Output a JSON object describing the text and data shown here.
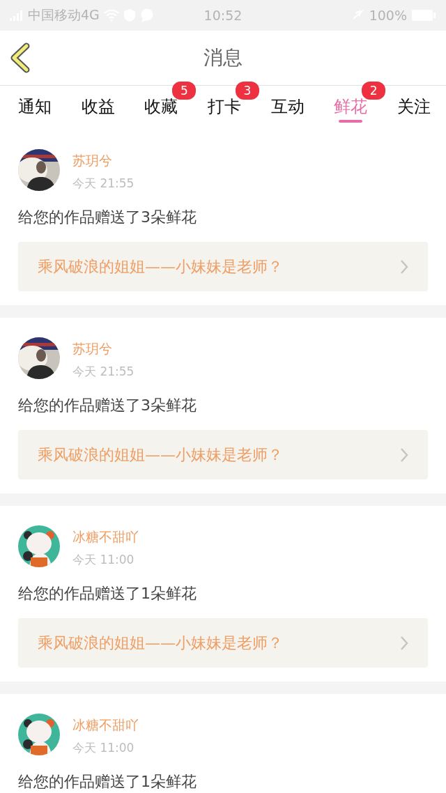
{
  "status_bar": {
    "carrier": "中国移动4G",
    "time": "10:52",
    "battery": "100%"
  },
  "header": {
    "title": "消息"
  },
  "tabs": [
    {
      "label": "通知",
      "selected": false
    },
    {
      "label": "收益",
      "selected": false
    },
    {
      "label": "收藏",
      "selected": false,
      "badge": "5"
    },
    {
      "label": "打卡",
      "selected": false,
      "badge": "3"
    },
    {
      "label": "互动",
      "selected": false
    },
    {
      "label": "鲜花",
      "selected": true,
      "badge": "2"
    },
    {
      "label": "关注",
      "selected": false
    }
  ],
  "messages": [
    {
      "name": "苏玥兮",
      "time": "今天 21:55",
      "text": "给您的作品赠送了3朵鲜花",
      "link": "乘风破浪的姐姐——小妹妹是老师？"
    },
    {
      "name": "苏玥兮",
      "time": "今天 21:55",
      "text": "给您的作品赠送了3朵鲜花",
      "link": "乘风破浪的姐姐——小妹妹是老师？"
    },
    {
      "name": "冰糖不甜吖",
      "time": "今天 11:00",
      "text": "给您的作品赠送了1朵鲜花",
      "link": "乘风破浪的姐姐——小妹妹是老师？"
    },
    {
      "name": "冰糖不甜吖",
      "time": "今天 11:00",
      "text": "给您的作品赠送了1朵鲜花"
    }
  ]
}
